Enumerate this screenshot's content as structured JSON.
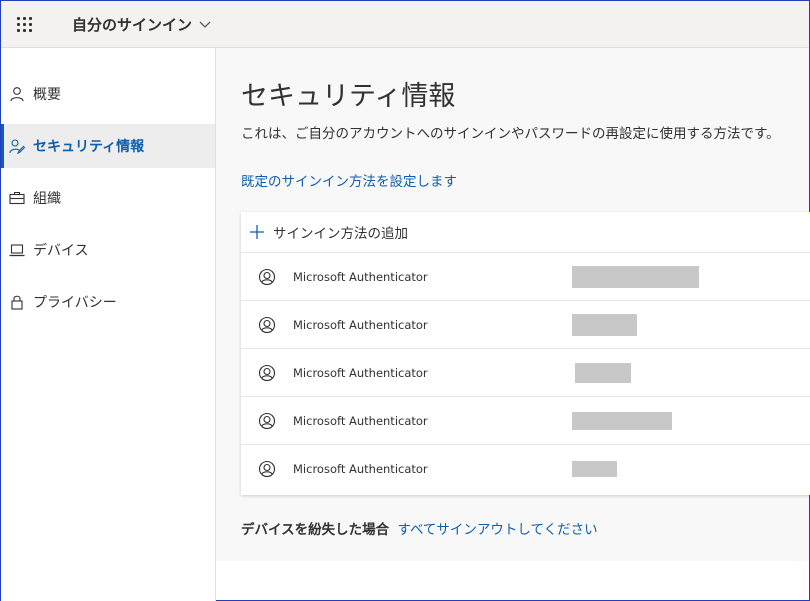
{
  "header": {
    "app_title": "自分のサインイン"
  },
  "sidebar": {
    "items": [
      {
        "label": "概要",
        "icon": "person-icon"
      },
      {
        "label": "セキュリティ情報",
        "icon": "person-key-icon",
        "active": true
      },
      {
        "label": "組織",
        "icon": "briefcase-icon"
      },
      {
        "label": "デバイス",
        "icon": "laptop-icon"
      },
      {
        "label": "プライバシー",
        "icon": "lock-icon"
      }
    ]
  },
  "main": {
    "title": "セキュリティ情報",
    "description": "これは、ご自分のアカウントへのサインインやパスワードの再設定に使用する方法です。",
    "default_method_link": "既定のサインイン方法を設定します",
    "add_method_label": "サインイン方法の追加",
    "methods": [
      {
        "name": "Microsoft Authenticator"
      },
      {
        "name": "Microsoft Authenticator"
      },
      {
        "name": "Microsoft Authenticator"
      },
      {
        "name": "Microsoft Authenticator"
      },
      {
        "name": "Microsoft Authenticator"
      }
    ],
    "lost_device_label": "デバイスを紛失した場合",
    "sign_out_link": "すべてサインアウトしてください"
  },
  "colors": {
    "accent": "#0f5dae",
    "active_bg": "#ededed",
    "redaction": "#c8c8c8"
  }
}
